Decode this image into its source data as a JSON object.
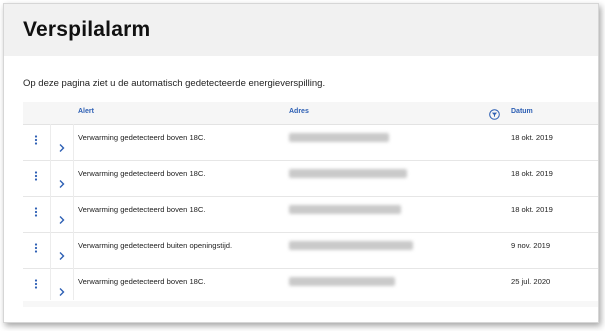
{
  "page": {
    "title": "Verspilalarm",
    "intro": "Op deze pagina ziet u de automatisch gedetecteerde energieverspilling."
  },
  "table": {
    "headers": {
      "alert": "Alert",
      "address": "Adres",
      "date": "Datum"
    },
    "filter_icon": "filter-icon",
    "address_redacted": true,
    "rows": [
      {
        "alert": "Verwarming gedetecteerd boven 18C.",
        "date": "18 okt. 2019"
      },
      {
        "alert": "Verwarming gedetecteerd boven 18C.",
        "date": "18 okt. 2019"
      },
      {
        "alert": "Verwarming gedetecteerd boven 18C.",
        "date": "18 okt. 2019"
      },
      {
        "alert": "Verwarming gedetecteerd buiten openingstijd.",
        "date": "9 nov. 2019"
      },
      {
        "alert": "Verwarming gedetecteerd boven 18C.",
        "date": "25 jul. 2020"
      }
    ]
  },
  "colors": {
    "header_text": "#2d5fb4",
    "icon": "#2d5fb4",
    "topbar": "#f1f1f1"
  }
}
